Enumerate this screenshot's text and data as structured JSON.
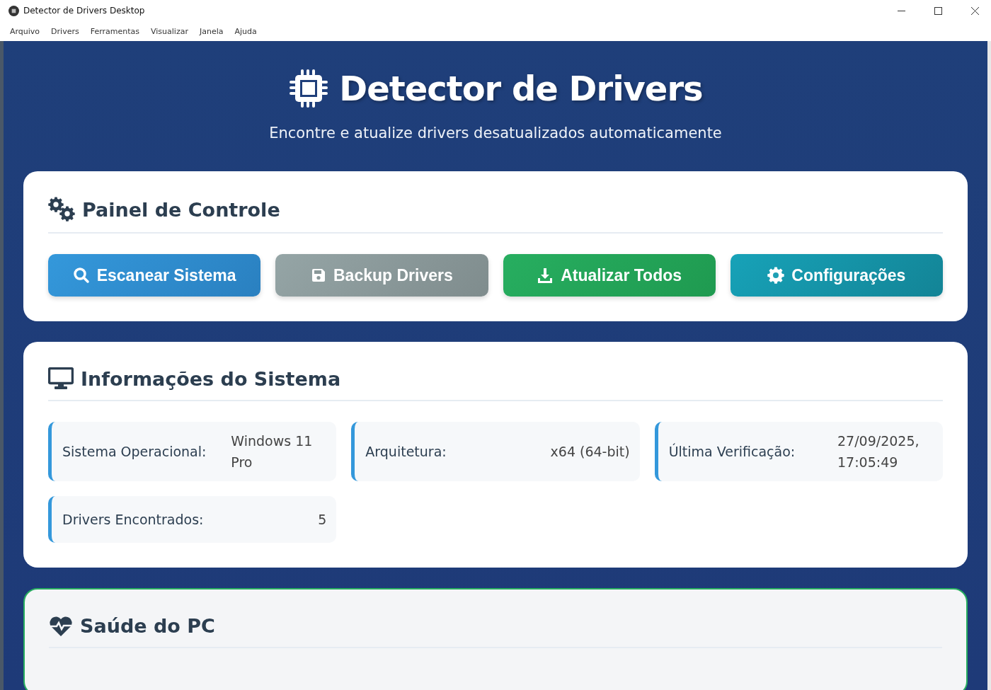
{
  "window": {
    "title": "Detector de Drivers Desktop"
  },
  "menu": [
    "Arquivo",
    "Drivers",
    "Ferramentas",
    "Visualizar",
    "Janela",
    "Ajuda"
  ],
  "header": {
    "title": "Detector de Drivers",
    "subtitle": "Encontre e atualize drivers desatualizados automaticamente"
  },
  "control_panel": {
    "title": "Painel de Controle",
    "buttons": [
      {
        "label": "Escanear Sistema",
        "kind": "primary"
      },
      {
        "label": "Backup Drivers",
        "kind": "secondary"
      },
      {
        "label": "Atualizar Todos",
        "kind": "success"
      },
      {
        "label": "Configurações",
        "kind": "info"
      }
    ]
  },
  "system_info": {
    "title": "Informações do Sistema",
    "items": [
      {
        "label": "Sistema Operacional:",
        "value": "Windows 11 Pro"
      },
      {
        "label": "Arquitetura:",
        "value": "x64 (64-bit)"
      },
      {
        "label": "Última Verificação:",
        "value": "27/09/2025, 17:05:49"
      },
      {
        "label": "Drivers Encontrados:",
        "value": "5"
      }
    ]
  },
  "pc_health": {
    "title": "Saúde do PC"
  }
}
